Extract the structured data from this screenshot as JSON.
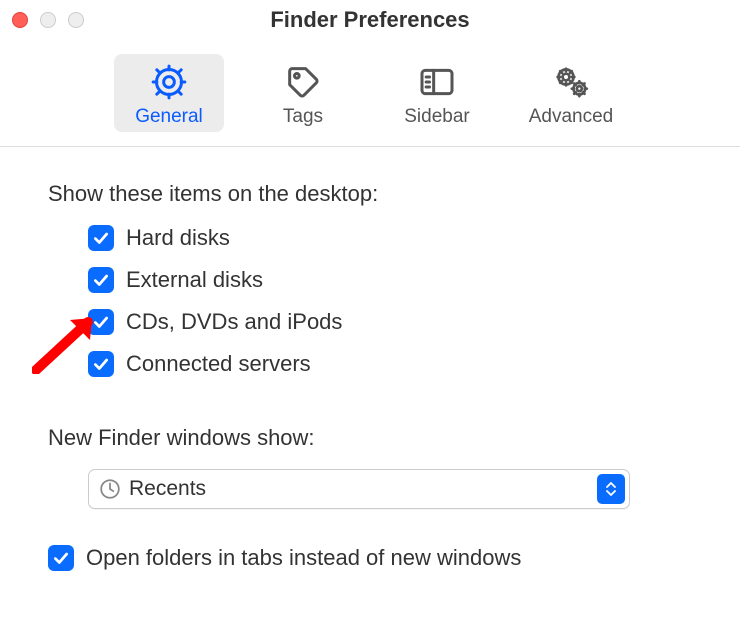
{
  "window": {
    "title": "Finder Preferences"
  },
  "tabs": {
    "general": "General",
    "tags": "Tags",
    "sidebar": "Sidebar",
    "advanced": "Advanced"
  },
  "desktop_section": {
    "heading": "Show these items on the desktop:",
    "items": [
      {
        "label": "Hard disks",
        "checked": true
      },
      {
        "label": "External disks",
        "checked": true
      },
      {
        "label": "CDs, DVDs and iPods",
        "checked": true
      },
      {
        "label": "Connected servers",
        "checked": true
      }
    ]
  },
  "new_windows": {
    "heading": "New Finder windows show:",
    "selected": "Recents"
  },
  "open_in_tabs": {
    "label": "Open folders in tabs instead of new windows",
    "checked": true
  }
}
